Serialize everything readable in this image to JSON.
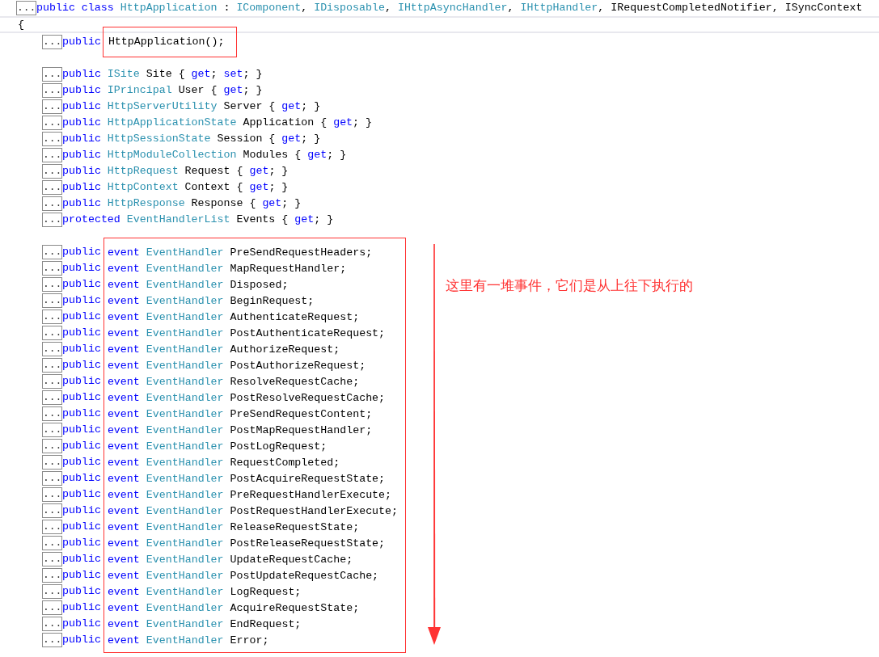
{
  "header": {
    "collapse": "...",
    "tokens": [
      {
        "text": "public class ",
        "kind": "keyword"
      },
      {
        "text": "HttpApplication",
        "kind": "type"
      },
      {
        "text": " : ",
        "kind": "plain"
      },
      {
        "text": "IComponent",
        "kind": "type"
      },
      {
        "text": ", ",
        "kind": "plain"
      },
      {
        "text": "IDisposable",
        "kind": "type"
      },
      {
        "text": ", ",
        "kind": "plain"
      },
      {
        "text": "IHttpAsyncHandler",
        "kind": "type"
      },
      {
        "text": ", ",
        "kind": "plain"
      },
      {
        "text": "IHttpHandler",
        "kind": "type"
      },
      {
        "text": ", IRequestCompletedNotifier, ISyncContext",
        "kind": "plain"
      }
    ]
  },
  "open_brace": "{",
  "constructor": {
    "collapse": "...",
    "prefix": "public",
    "boxed": "HttpApplication();",
    "highlighted": true
  },
  "properties": [
    {
      "collapse": "...",
      "tokens": [
        {
          "text": "public ",
          "kind": "keyword"
        },
        {
          "text": "ISite",
          "kind": "type"
        },
        {
          "text": " Site { ",
          "kind": "plain"
        },
        {
          "text": "get",
          "kind": "keyword"
        },
        {
          "text": "; ",
          "kind": "plain"
        },
        {
          "text": "set",
          "kind": "keyword"
        },
        {
          "text": "; }",
          "kind": "plain"
        }
      ]
    },
    {
      "collapse": "...",
      "tokens": [
        {
          "text": "public ",
          "kind": "keyword"
        },
        {
          "text": "IPrincipal",
          "kind": "type"
        },
        {
          "text": " User { ",
          "kind": "plain"
        },
        {
          "text": "get",
          "kind": "keyword"
        },
        {
          "text": "; }",
          "kind": "plain"
        }
      ]
    },
    {
      "collapse": "...",
      "tokens": [
        {
          "text": "public ",
          "kind": "keyword"
        },
        {
          "text": "HttpServerUtility",
          "kind": "type"
        },
        {
          "text": " Server { ",
          "kind": "plain"
        },
        {
          "text": "get",
          "kind": "keyword"
        },
        {
          "text": "; }",
          "kind": "plain"
        }
      ]
    },
    {
      "collapse": "...",
      "tokens": [
        {
          "text": "public ",
          "kind": "keyword"
        },
        {
          "text": "HttpApplicationState",
          "kind": "type"
        },
        {
          "text": " Application { ",
          "kind": "plain"
        },
        {
          "text": "get",
          "kind": "keyword"
        },
        {
          "text": "; }",
          "kind": "plain"
        }
      ]
    },
    {
      "collapse": "...",
      "tokens": [
        {
          "text": "public ",
          "kind": "keyword"
        },
        {
          "text": "HttpSessionState",
          "kind": "type"
        },
        {
          "text": " Session { ",
          "kind": "plain"
        },
        {
          "text": "get",
          "kind": "keyword"
        },
        {
          "text": "; }",
          "kind": "plain"
        }
      ]
    },
    {
      "collapse": "...",
      "tokens": [
        {
          "text": "public ",
          "kind": "keyword"
        },
        {
          "text": "HttpModuleCollection",
          "kind": "type"
        },
        {
          "text": " Modules { ",
          "kind": "plain"
        },
        {
          "text": "get",
          "kind": "keyword"
        },
        {
          "text": "; }",
          "kind": "plain"
        }
      ]
    },
    {
      "collapse": "...",
      "tokens": [
        {
          "text": "public ",
          "kind": "keyword"
        },
        {
          "text": "HttpRequest",
          "kind": "type"
        },
        {
          "text": " Request { ",
          "kind": "plain"
        },
        {
          "text": "get",
          "kind": "keyword"
        },
        {
          "text": "; }",
          "kind": "plain"
        }
      ]
    },
    {
      "collapse": "...",
      "tokens": [
        {
          "text": "public ",
          "kind": "keyword"
        },
        {
          "text": "HttpContext",
          "kind": "type"
        },
        {
          "text": " Context { ",
          "kind": "plain"
        },
        {
          "text": "get",
          "kind": "keyword"
        },
        {
          "text": "; }",
          "kind": "plain"
        }
      ]
    },
    {
      "collapse": "...",
      "tokens": [
        {
          "text": "public ",
          "kind": "keyword"
        },
        {
          "text": "HttpResponse",
          "kind": "type"
        },
        {
          "text": " Response { ",
          "kind": "plain"
        },
        {
          "text": "get",
          "kind": "keyword"
        },
        {
          "text": "; }",
          "kind": "plain"
        }
      ]
    },
    {
      "collapse": "...",
      "tokens": [
        {
          "text": "protected ",
          "kind": "keyword"
        },
        {
          "text": "EventHandlerList",
          "kind": "type"
        },
        {
          "text": " Events { ",
          "kind": "plain"
        },
        {
          "text": "get",
          "kind": "keyword"
        },
        {
          "text": "; }",
          "kind": "plain"
        }
      ]
    }
  ],
  "events": {
    "highlighted": true,
    "rows": [
      {
        "collapse": "...",
        "prefix": "public",
        "event_keyword": "event",
        "handler_type": "EventHandler",
        "name": "PreSendRequestHeaders;"
      },
      {
        "collapse": "...",
        "prefix": "public",
        "event_keyword": "event",
        "handler_type": "EventHandler",
        "name": "MapRequestHandler;"
      },
      {
        "collapse": "...",
        "prefix": "public",
        "event_keyword": "event",
        "handler_type": "EventHandler",
        "name": "Disposed;"
      },
      {
        "collapse": "...",
        "prefix": "public",
        "event_keyword": "event",
        "handler_type": "EventHandler",
        "name": "BeginRequest;"
      },
      {
        "collapse": "...",
        "prefix": "public",
        "event_keyword": "event",
        "handler_type": "EventHandler",
        "name": "AuthenticateRequest;"
      },
      {
        "collapse": "...",
        "prefix": "public",
        "event_keyword": "event",
        "handler_type": "EventHandler",
        "name": "PostAuthenticateRequest;"
      },
      {
        "collapse": "...",
        "prefix": "public",
        "event_keyword": "event",
        "handler_type": "EventHandler",
        "name": "AuthorizeRequest;"
      },
      {
        "collapse": "...",
        "prefix": "public",
        "event_keyword": "event",
        "handler_type": "EventHandler",
        "name": "PostAuthorizeRequest;"
      },
      {
        "collapse": "...",
        "prefix": "public",
        "event_keyword": "event",
        "handler_type": "EventHandler",
        "name": "ResolveRequestCache;"
      },
      {
        "collapse": "...",
        "prefix": "public",
        "event_keyword": "event",
        "handler_type": "EventHandler",
        "name": "PostResolveRequestCache;"
      },
      {
        "collapse": "...",
        "prefix": "public",
        "event_keyword": "event",
        "handler_type": "EventHandler",
        "name": "PreSendRequestContent;"
      },
      {
        "collapse": "...",
        "prefix": "public",
        "event_keyword": "event",
        "handler_type": "EventHandler",
        "name": "PostMapRequestHandler;"
      },
      {
        "collapse": "...",
        "prefix": "public",
        "event_keyword": "event",
        "handler_type": "EventHandler",
        "name": "PostLogRequest;"
      },
      {
        "collapse": "...",
        "prefix": "public",
        "event_keyword": "event",
        "handler_type": "EventHandler",
        "name": "RequestCompleted;"
      },
      {
        "collapse": "...",
        "prefix": "public",
        "event_keyword": "event",
        "handler_type": "EventHandler",
        "name": "PostAcquireRequestState;"
      },
      {
        "collapse": "...",
        "prefix": "public",
        "event_keyword": "event",
        "handler_type": "EventHandler",
        "name": "PreRequestHandlerExecute;"
      },
      {
        "collapse": "...",
        "prefix": "public",
        "event_keyword": "event",
        "handler_type": "EventHandler",
        "name": "PostRequestHandlerExecute;"
      },
      {
        "collapse": "...",
        "prefix": "public",
        "event_keyword": "event",
        "handler_type": "EventHandler",
        "name": "ReleaseRequestState;"
      },
      {
        "collapse": "...",
        "prefix": "public",
        "event_keyword": "event",
        "handler_type": "EventHandler",
        "name": "PostReleaseRequestState;"
      },
      {
        "collapse": "...",
        "prefix": "public",
        "event_keyword": "event",
        "handler_type": "EventHandler",
        "name": "UpdateRequestCache;"
      },
      {
        "collapse": "...",
        "prefix": "public",
        "event_keyword": "event",
        "handler_type": "EventHandler",
        "name": "PostUpdateRequestCache;"
      },
      {
        "collapse": "...",
        "prefix": "public",
        "event_keyword": "event",
        "handler_type": "EventHandler",
        "name": "LogRequest;"
      },
      {
        "collapse": "...",
        "prefix": "public",
        "event_keyword": "event",
        "handler_type": "EventHandler",
        "name": "AcquireRequestState;"
      },
      {
        "collapse": "...",
        "prefix": "public",
        "event_keyword": "event",
        "handler_type": "EventHandler",
        "name": "EndRequest;"
      },
      {
        "collapse": "...",
        "prefix": "public",
        "event_keyword": "event",
        "handler_type": "EventHandler",
        "name": "Error;"
      }
    ]
  },
  "note": "这里有一堆事件，它们是从上往下执行的"
}
